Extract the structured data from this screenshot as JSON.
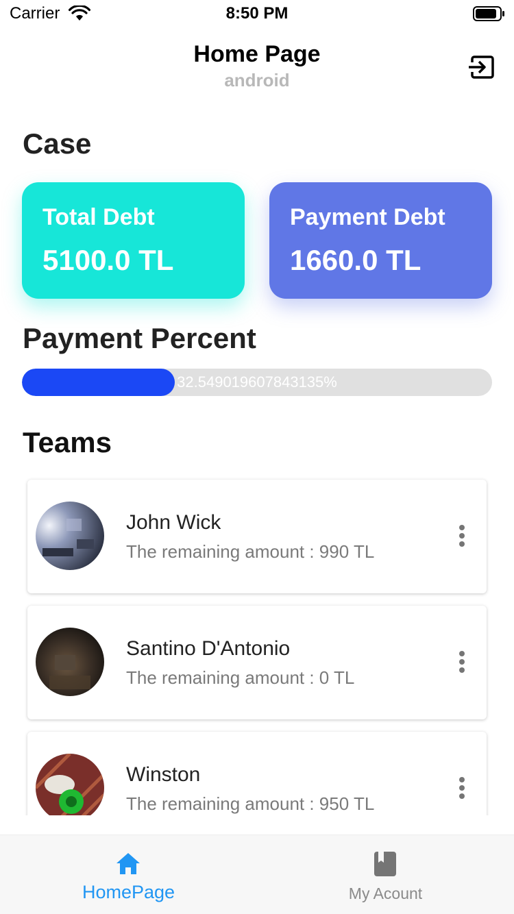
{
  "status_bar": {
    "carrier": "Carrier",
    "time": "8:50 PM",
    "icons": [
      "wifi-icon",
      "battery-icon"
    ]
  },
  "header": {
    "title": "Home Page",
    "subtitle": "android",
    "logout_icon": "exit-icon"
  },
  "case": {
    "title": "Case",
    "cards": [
      {
        "label": "Total Debt",
        "value": "5100.0 TL",
        "color": "#17e6d8"
      },
      {
        "label": "Payment Debt",
        "value": "1660.0 TL",
        "color": "#6077e6"
      }
    ]
  },
  "payment_percent": {
    "title": "Payment Percent",
    "text": "32.549019607843135%",
    "value": 0.3255,
    "fill_color": "#1b48f5",
    "track_color": "#e0e0e0"
  },
  "teams": {
    "title": "Teams",
    "items": [
      {
        "name": "John Wick",
        "amount": "The remaining amount : 990 TL"
      },
      {
        "name": "Santino D'Antonio",
        "amount": "The remaining amount : 0 TL"
      },
      {
        "name": "Winston",
        "amount": "The remaining amount : 950 TL"
      }
    ],
    "menu_icon": "more-vertical-icon"
  },
  "bottom_nav": {
    "tabs": [
      {
        "label": "HomePage",
        "icon": "home-icon",
        "active": true,
        "color": "#2196f3"
      },
      {
        "label": "My Acount",
        "icon": "book-icon",
        "active": false,
        "color": "#8a8a8a"
      }
    ]
  }
}
